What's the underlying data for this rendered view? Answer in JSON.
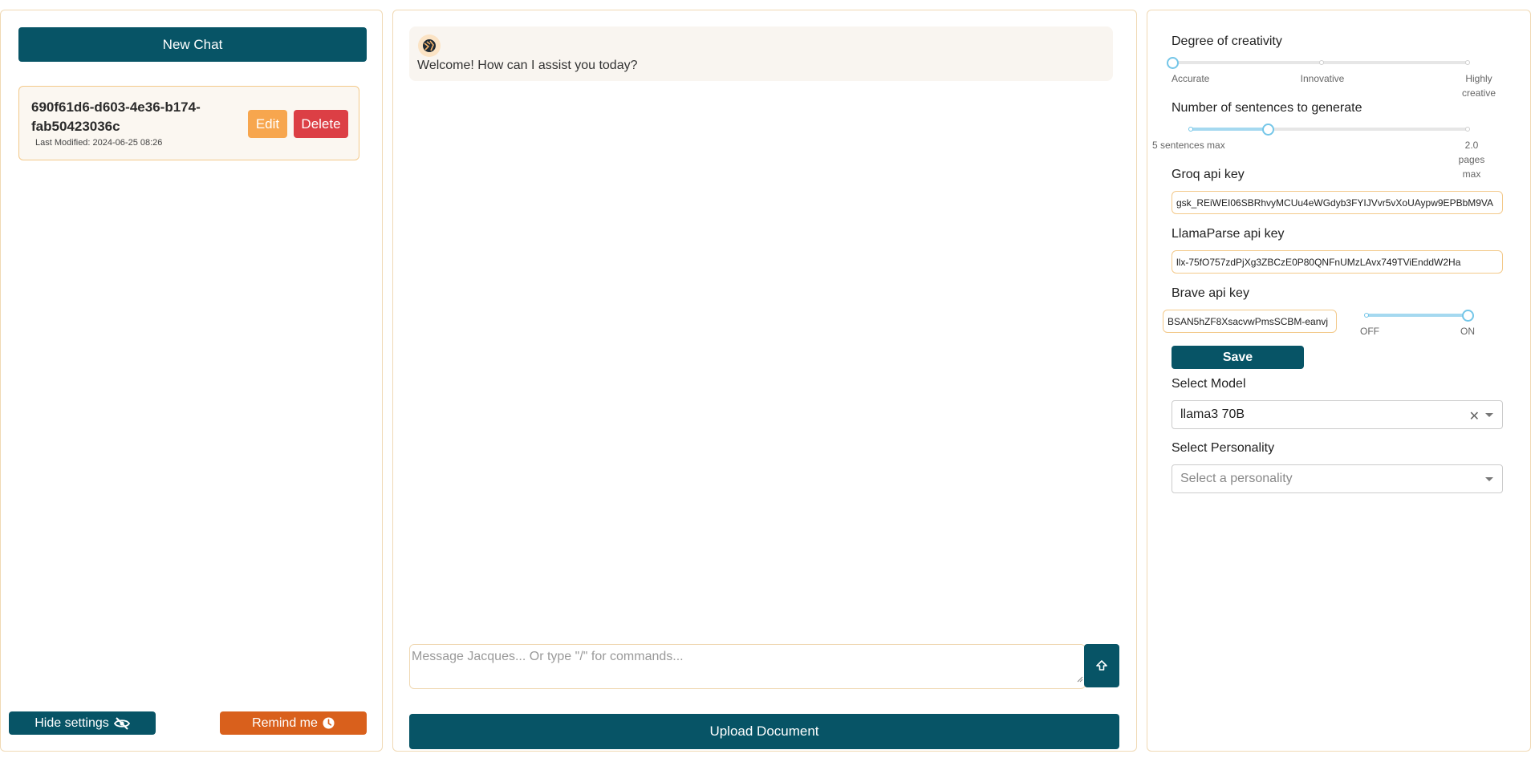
{
  "sidebar": {
    "new_chat_label": "New Chat",
    "chats": [
      {
        "title": "690f61d6-d603-4e36-b174-fab50423036c",
        "last_modified": "Last Modified: 2024-06-25 08:26",
        "edit_label": "Edit",
        "delete_label": "Delete"
      }
    ],
    "hide_settings_label": "Hide settings",
    "remind_me_label": "Remind me"
  },
  "chat": {
    "messages": [
      {
        "text": "Welcome! How can I assist you today?"
      }
    ],
    "input_placeholder": "Message Jacques... Or type \"/\" for commands...",
    "upload_label": "Upload Document"
  },
  "settings": {
    "creativity": {
      "label": "Degree of creativity",
      "marks": [
        "Accurate",
        "Innovative",
        "Highly creative"
      ],
      "value_index": 0
    },
    "sentences": {
      "label": "Number of sentences to generate",
      "min_label": "5 sentences max",
      "max_label": "2.0 pages max",
      "value_fraction": 0.26
    },
    "groq": {
      "label": "Groq api key",
      "value": "gsk_REiWEI06SBRhvyMCUu4eWGdyb3FYIJVvr5vXoUAypw9EPBbM9VA"
    },
    "llamaparse": {
      "label": "LlamaParse api key",
      "value": "llx-75fO757zdPjXg3ZBCzE0P80QNFnUMzLAvx749TViEnddW2Ha"
    },
    "brave": {
      "label": "Brave api key",
      "value": "BSAN5hZF8XsacvwPmsSCBM-eanvj",
      "toggle_off_label": "OFF",
      "toggle_on_label": "ON",
      "enabled": true
    },
    "save_label": "Save",
    "model": {
      "label": "Select Model",
      "value": "llama3 70B"
    },
    "personality": {
      "label": "Select Personality",
      "placeholder": "Select a personality"
    }
  },
  "colors": {
    "primary": "#075466",
    "edit": "#f7a64e",
    "delete": "#dc3f45",
    "remind": "#d9601c",
    "slider": "#74c6e8",
    "panel_border": "#f0d9b4"
  }
}
